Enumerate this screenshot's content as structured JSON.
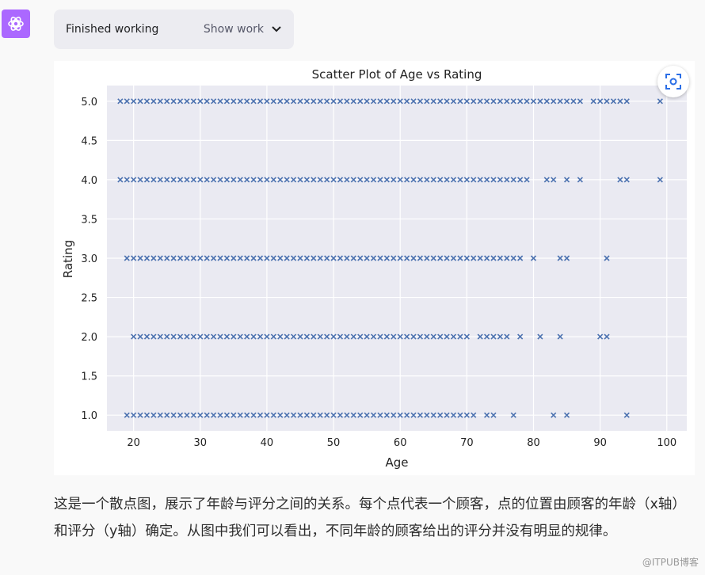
{
  "status": {
    "title": "Finished working",
    "show_label": "Show work"
  },
  "icons": {
    "logo": "openai-logo-icon",
    "expand": "expand-image-icon",
    "chevron": "chevron-down-icon"
  },
  "description": "这是一个散点图，展示了年龄与评分之间的关系。每个点代表一个顾客，点的位置由顾客的年龄（x轴）和评分（y轴）确定。从图中我们可以看出，不同年龄的顾客给出的评分并没有明显的规律。",
  "watermark": "@ITPUB博客",
  "chart_data": {
    "type": "scatter",
    "title": "Scatter Plot of Age vs Rating",
    "xlabel": "Age",
    "ylabel": "Rating",
    "xlim": [
      16,
      103
    ],
    "ylim": [
      0.8,
      5.2
    ],
    "xticks": [
      20,
      30,
      40,
      50,
      60,
      70,
      80,
      90,
      100
    ],
    "yticks": [
      1.0,
      1.5,
      2.0,
      2.5,
      3.0,
      3.5,
      4.0,
      4.5,
      5.0
    ],
    "marker": "x",
    "color": "#4c72b0",
    "grid": true,
    "series": [
      {
        "rating": 5.0,
        "ranges": [
          [
            18,
            87
          ],
          [
            89,
            94
          ]
        ],
        "ages": [
          99
        ]
      },
      {
        "rating": 4.0,
        "ranges": [
          [
            18,
            79
          ]
        ],
        "ages": [
          82,
          83,
          85,
          87,
          93,
          94,
          99
        ]
      },
      {
        "rating": 3.0,
        "ranges": [
          [
            19,
            78
          ]
        ],
        "ages": [
          80,
          84,
          85,
          91
        ]
      },
      {
        "rating": 2.0,
        "ranges": [
          [
            20,
            70
          ],
          [
            72,
            76
          ]
        ],
        "ages": [
          78,
          81,
          84,
          90,
          91
        ]
      },
      {
        "rating": 1.0,
        "ranges": [
          [
            19,
            71
          ]
        ],
        "ages": [
          73,
          74,
          77,
          83,
          85,
          94
        ]
      }
    ]
  }
}
